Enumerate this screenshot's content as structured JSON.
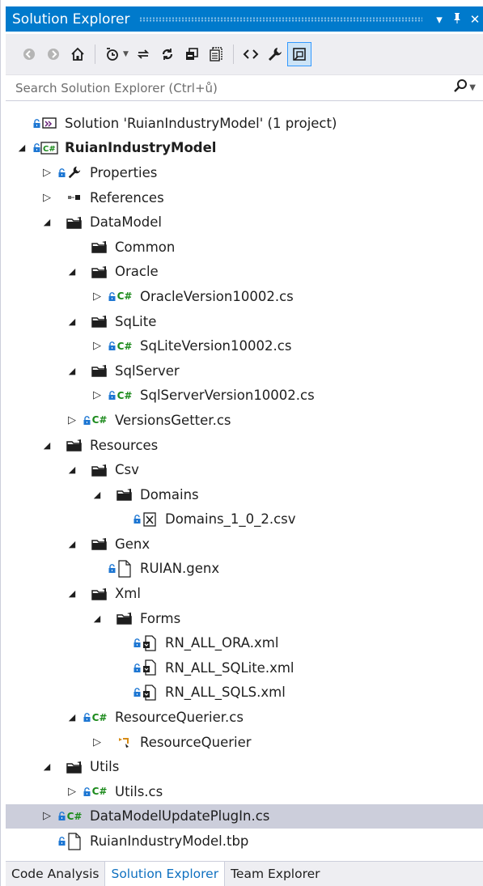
{
  "window": {
    "title": "Solution Explorer",
    "buttons": {
      "dropdown": "▾",
      "pin": "ᵖ",
      "close": "✕"
    }
  },
  "toolbar": {
    "buttons": [
      {
        "name": "back-icon",
        "glyph": "◀"
      },
      {
        "name": "forward-icon",
        "glyph": "▶"
      },
      {
        "name": "home-icon",
        "glyph": "⌂"
      },
      {
        "name": "pending-changes-filter-icon",
        "glyph": "◔"
      },
      {
        "name": "sync-active-document-icon",
        "glyph": "⇄"
      },
      {
        "name": "refresh-icon",
        "glyph": "↻"
      },
      {
        "name": "collapse-all-icon",
        "glyph": "⧉"
      },
      {
        "name": "show-all-files-icon",
        "glyph": "▤"
      },
      {
        "name": "view-code-icon",
        "glyph": "<>"
      },
      {
        "name": "properties-icon",
        "glyph": "🔧"
      },
      {
        "name": "preview-selected-items-icon",
        "glyph": "▣"
      }
    ]
  },
  "search": {
    "placeholder": "Search Solution Explorer (Ctrl+ů)"
  },
  "tree": [
    {
      "label": "Solution 'RuianIndustryModel' (1 project)",
      "depth": 0,
      "expander": "none",
      "lock": true,
      "icon": "solution"
    },
    {
      "label": "RuianIndustryModel",
      "depth": 0,
      "expander": "expanded",
      "lock": true,
      "icon": "csproj",
      "bold": true
    },
    {
      "label": "Properties",
      "depth": 1,
      "expander": "collapsed",
      "lock": true,
      "icon": "wrench"
    },
    {
      "label": "References",
      "depth": 1,
      "expander": "collapsed",
      "lock": false,
      "icon": "references"
    },
    {
      "label": "DataModel",
      "depth": 1,
      "expander": "expanded",
      "lock": false,
      "icon": "folder"
    },
    {
      "label": "Common",
      "depth": 2,
      "expander": "none",
      "lock": false,
      "icon": "folder"
    },
    {
      "label": "Oracle",
      "depth": 2,
      "expander": "expanded",
      "lock": false,
      "icon": "folder"
    },
    {
      "label": "OracleVersion10002.cs",
      "depth": 3,
      "expander": "collapsed",
      "lock": true,
      "icon": "cs"
    },
    {
      "label": "SqLite",
      "depth": 2,
      "expander": "expanded",
      "lock": false,
      "icon": "folder"
    },
    {
      "label": "SqLiteVersion10002.cs",
      "depth": 3,
      "expander": "collapsed",
      "lock": true,
      "icon": "cs"
    },
    {
      "label": "SqlServer",
      "depth": 2,
      "expander": "expanded",
      "lock": false,
      "icon": "folder"
    },
    {
      "label": "SqlServerVersion10002.cs",
      "depth": 3,
      "expander": "collapsed",
      "lock": true,
      "icon": "cs"
    },
    {
      "label": "VersionsGetter.cs",
      "depth": 2,
      "expander": "collapsed",
      "lock": true,
      "icon": "cs"
    },
    {
      "label": "Resources",
      "depth": 1,
      "expander": "expanded",
      "lock": false,
      "icon": "folder"
    },
    {
      "label": "Csv",
      "depth": 2,
      "expander": "expanded",
      "lock": false,
      "icon": "folder"
    },
    {
      "label": "Domains",
      "depth": 3,
      "expander": "expanded",
      "lock": false,
      "icon": "folder"
    },
    {
      "label": "Domains_1_0_2.csv",
      "depth": 4,
      "expander": "none",
      "lock": true,
      "icon": "csv"
    },
    {
      "label": "Genx",
      "depth": 2,
      "expander": "expanded",
      "lock": false,
      "icon": "folder"
    },
    {
      "label": "RUIAN.genx",
      "depth": 3,
      "expander": "none",
      "lock": true,
      "icon": "file"
    },
    {
      "label": "Xml",
      "depth": 2,
      "expander": "expanded",
      "lock": false,
      "icon": "folder"
    },
    {
      "label": "Forms",
      "depth": 3,
      "expander": "expanded",
      "lock": false,
      "icon": "folder"
    },
    {
      "label": "RN_ALL_ORA.xml",
      "depth": 4,
      "expander": "none",
      "lock": true,
      "icon": "xml"
    },
    {
      "label": "RN_ALL_SQLite.xml",
      "depth": 4,
      "expander": "none",
      "lock": true,
      "icon": "xml"
    },
    {
      "label": "RN_ALL_SQLS.xml",
      "depth": 4,
      "expander": "none",
      "lock": true,
      "icon": "xml"
    },
    {
      "label": "ResourceQuerier.cs",
      "depth": 2,
      "expander": "expanded",
      "lock": true,
      "icon": "cs"
    },
    {
      "label": "ResourceQuerier",
      "depth": 3,
      "expander": "collapsed",
      "lock": false,
      "icon": "class"
    },
    {
      "label": "Utils",
      "depth": 1,
      "expander": "expanded",
      "lock": false,
      "icon": "folder"
    },
    {
      "label": "Utils.cs",
      "depth": 2,
      "expander": "collapsed",
      "lock": true,
      "icon": "cs"
    },
    {
      "label": "DataModelUpdatePlugIn.cs",
      "depth": 1,
      "expander": "collapsed",
      "lock": true,
      "icon": "cs",
      "selected": true
    },
    {
      "label": "RuianIndustryModel.tbp",
      "depth": 1,
      "expander": "none",
      "lock": true,
      "icon": "file"
    }
  ],
  "tabs": [
    {
      "label": "Code Analysis",
      "active": false
    },
    {
      "label": "Solution Explorer",
      "active": true
    },
    {
      "label": "Team Explorer",
      "active": false
    }
  ],
  "colors": {
    "accent": "#007acc",
    "selection": "#cccedb",
    "csharp": "#1b8a1b",
    "lock": "#1e77d3"
  }
}
